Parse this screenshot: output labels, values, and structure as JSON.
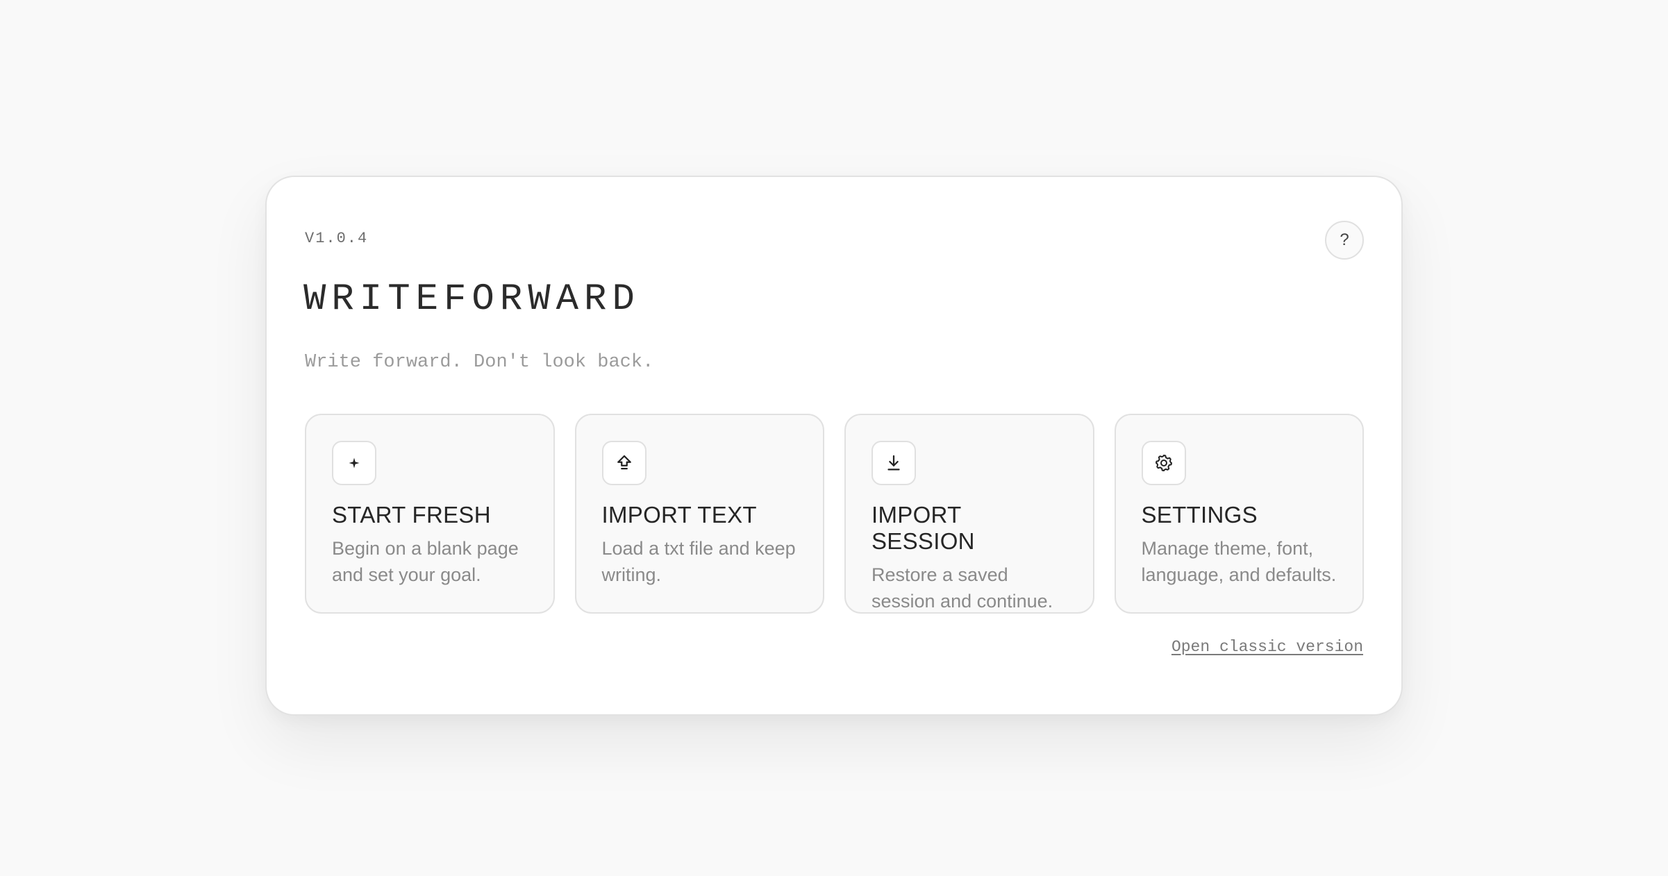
{
  "modal": {
    "version": "V1.0.4",
    "help_label": "?",
    "title": "WRITEFORWARD",
    "tagline": "Write forward. Don't look back."
  },
  "cards": [
    {
      "icon": "sparkle-icon",
      "title": "START FRESH",
      "description": "Begin on a blank page and set your goal."
    },
    {
      "icon": "upload-icon",
      "title": "IMPORT TEXT",
      "description": "Load a txt file and keep writing."
    },
    {
      "icon": "download-icon",
      "title": "IMPORT SESSION",
      "description": "Restore a saved session and continue."
    },
    {
      "icon": "gear-icon",
      "title": "SETTINGS",
      "description": "Manage theme, font, language, and defaults."
    }
  ],
  "footer": {
    "classic_link": "Open classic version"
  }
}
